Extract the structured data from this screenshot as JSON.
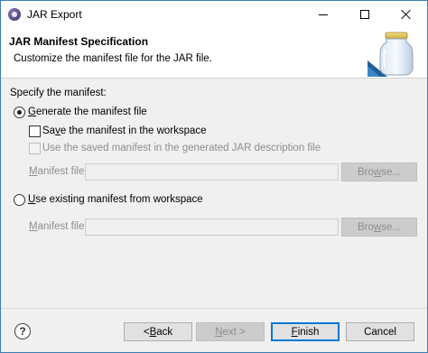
{
  "window": {
    "title": "JAR Export",
    "app_icon": "eclipse-icon",
    "controls": [
      "minimize-icon",
      "maximize-icon",
      "close-icon"
    ]
  },
  "banner": {
    "title": "JAR Manifest Specification",
    "description": "Customize the manifest file for the JAR file.",
    "icon": "jar-icon"
  },
  "form": {
    "section_label": "Specify the manifest:",
    "generate": {
      "mnemonic": "G",
      "rest": "enerate the manifest file",
      "checked": true
    },
    "save_manifest": {
      "pre": "Sa",
      "mnemonic": "v",
      "rest": "e the manifest in the workspace",
      "checked": false,
      "enabled": true
    },
    "use_saved": {
      "label": "Use the saved manifest in the generated JAR description file",
      "checked": false,
      "enabled": false
    },
    "manifest_file_1": {
      "mnemonic": "M",
      "rest": "anifest file:",
      "value": "",
      "enabled": false,
      "browse": {
        "pre": "Bro",
        "mnemonic": "w",
        "rest": "se..."
      }
    },
    "use_existing": {
      "mnemonic": "U",
      "rest": "se existing manifest from workspace",
      "checked": false
    },
    "manifest_file_2": {
      "mnemonic": "M",
      "rest": "anifest file:",
      "value": "",
      "enabled": false,
      "browse": {
        "pre": "Bro",
        "mnemonic": "w",
        "rest": "se..."
      }
    }
  },
  "footer": {
    "help_icon": "help-icon",
    "back": {
      "pre": "< ",
      "mnemonic": "B",
      "rest": "ack"
    },
    "next": {
      "mnemonic": "N",
      "rest": "ext >",
      "enabled": false
    },
    "finish": {
      "mnemonic": "F",
      "rest": "inish"
    },
    "cancel": {
      "label": "Cancel"
    }
  },
  "colors": {
    "window_border": "#3c7fb1",
    "dialog_bg": "#f0f0f0",
    "primary_button_border": "#0078d7",
    "disabled_text": "#8d8d8d"
  }
}
